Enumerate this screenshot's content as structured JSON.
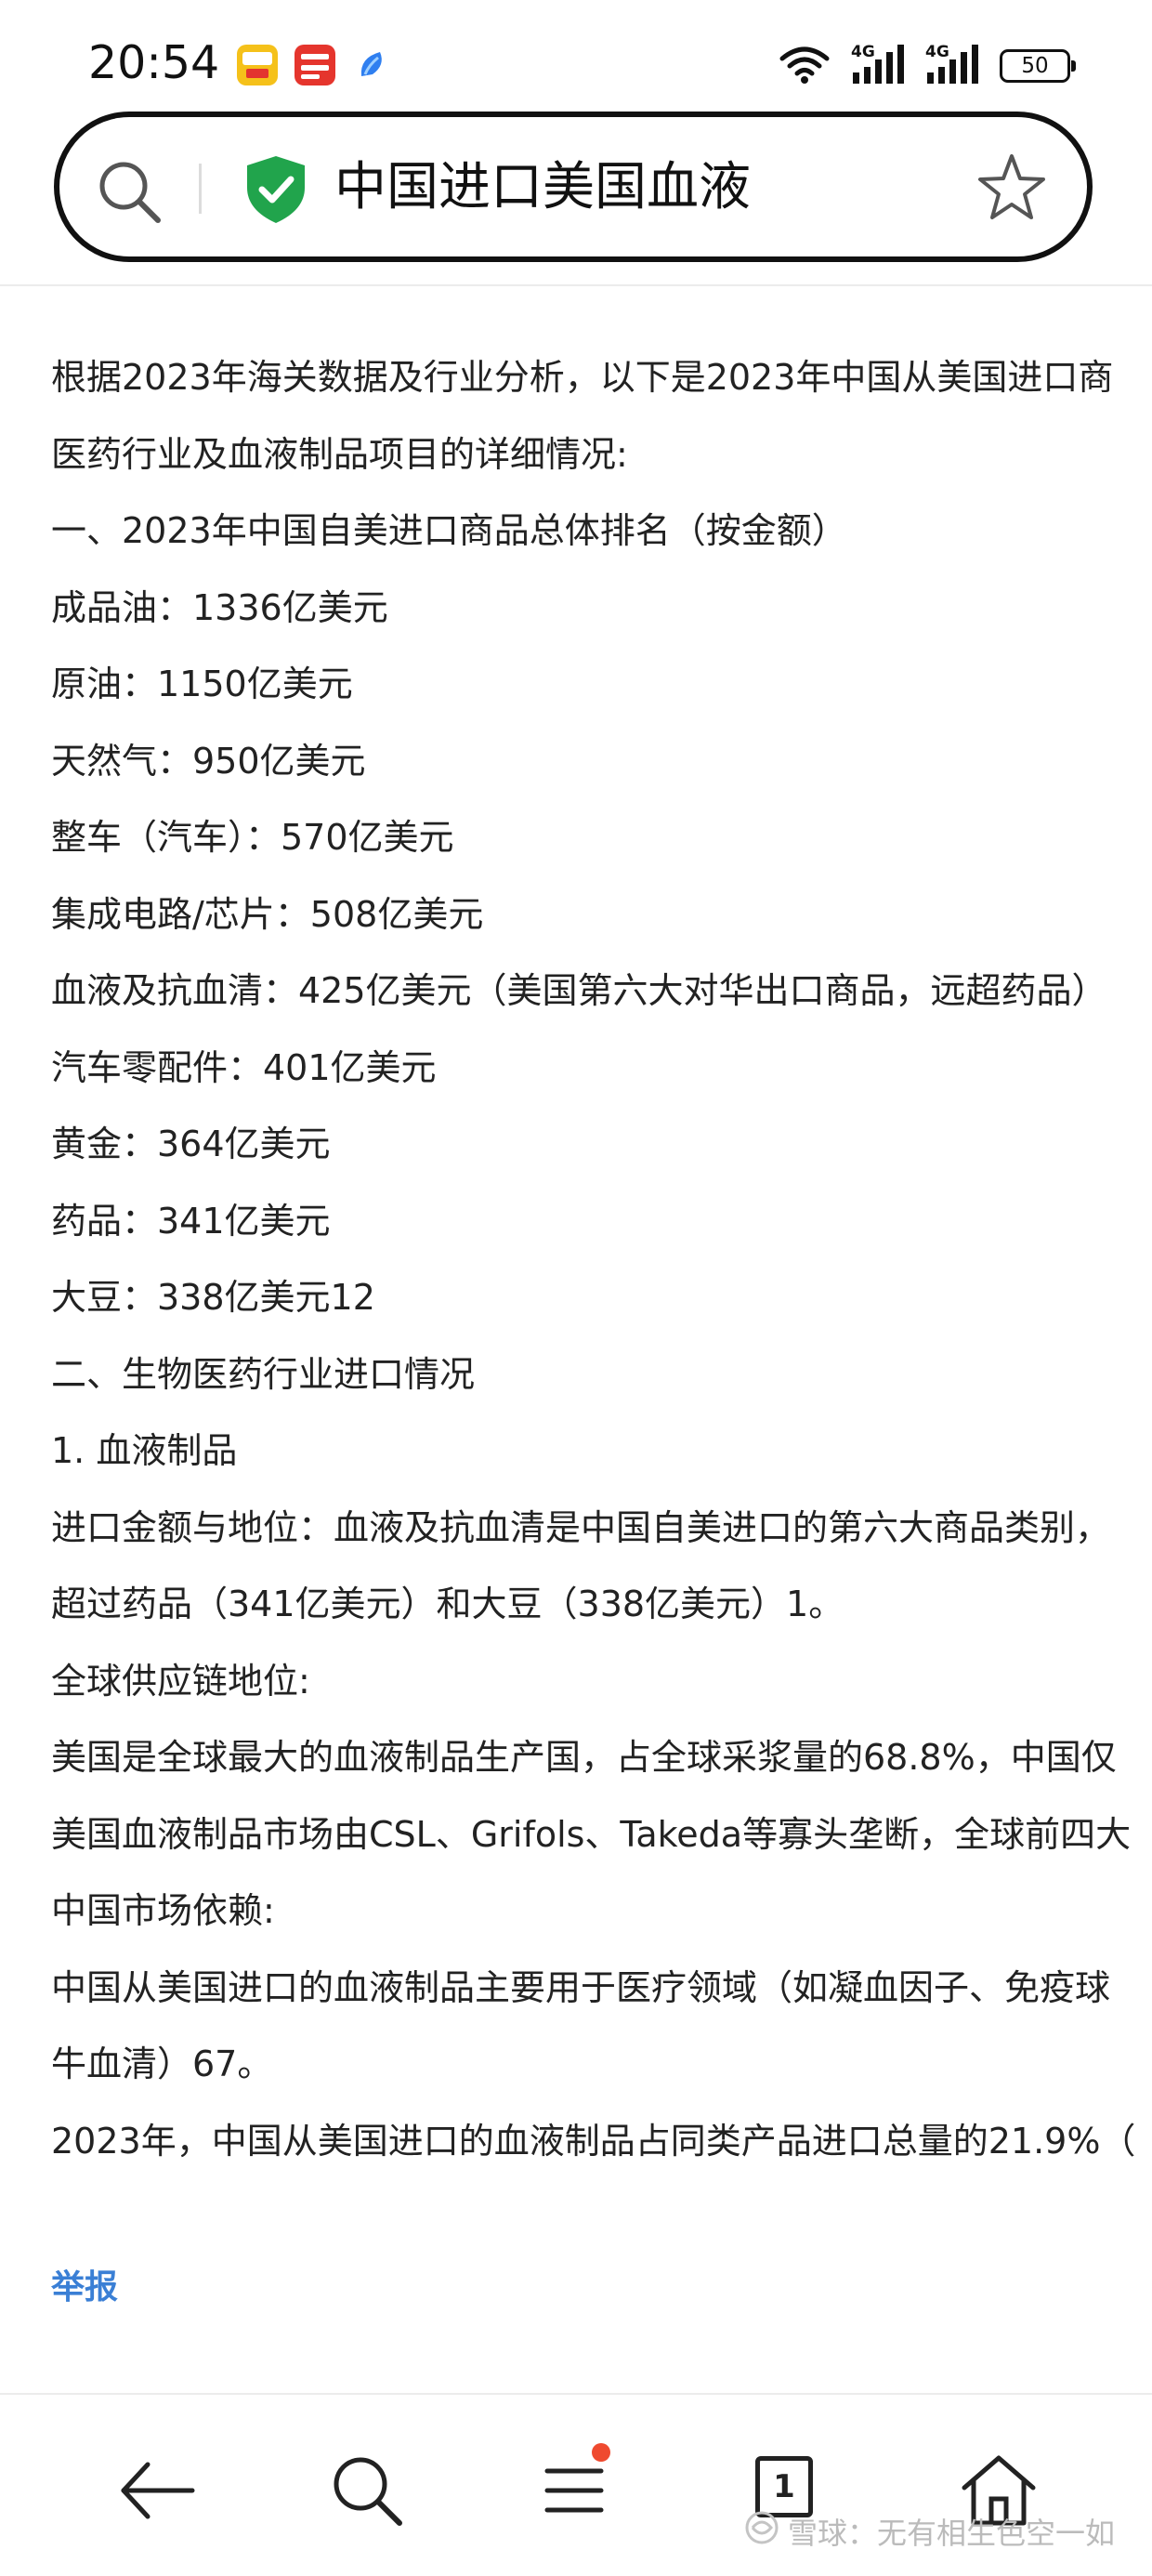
{
  "status_bar": {
    "time": "20:54",
    "network_1": "4G",
    "network_2": "4G",
    "battery": "50"
  },
  "search": {
    "query": "中国进口美国血液"
  },
  "content": {
    "lines": [
      "根据2023年海关数据及行业分析，以下是2023年中国从美国进口商",
      "医药行业及血液制品项目的详细情况:",
      "一、2023年中国自美进口商品总体排名（按金额）",
      "成品油：1336亿美元",
      "原油：1150亿美元",
      "天然气：950亿美元",
      "整车（汽车）：570亿美元",
      "集成电路/芯片：508亿美元",
      "血液及抗血清：425亿美元（美国第六大对华出口商品，远超药品）",
      "汽车零配件：401亿美元",
      "黄金：364亿美元",
      "药品：341亿美元",
      "大豆：338亿美元12",
      "二、生物医药行业进口情况",
      "1. 血液制品",
      "进口金额与地位：血液及抗血清是中国自美进口的第六大商品类别，",
      "超过药品（341亿美元）和大豆（338亿美元）1。",
      "全球供应链地位:",
      "美国是全球最大的血液制品生产国，占全球采浆量的68.8%，中国仅",
      "美国血液制品市场由CSL、Grifols、Takeda等寡头垄断，全球前四大",
      "中国市场依赖:",
      "中国从美国进口的血液制品主要用于医疗领域（如凝血因子、免疫球",
      "牛血清）67。",
      "2023年，中国从美国进口的血液制品占同类产品进口总量的21.9%（"
    ],
    "report_label": "举报"
  },
  "bottom_nav": {
    "tab_count": "1"
  },
  "watermark": {
    "text": "雪球：无有相生色空一如"
  },
  "colors": {
    "link": "#3a7fd5",
    "shield": "#21a44c",
    "badge": "#ef4a2f"
  }
}
